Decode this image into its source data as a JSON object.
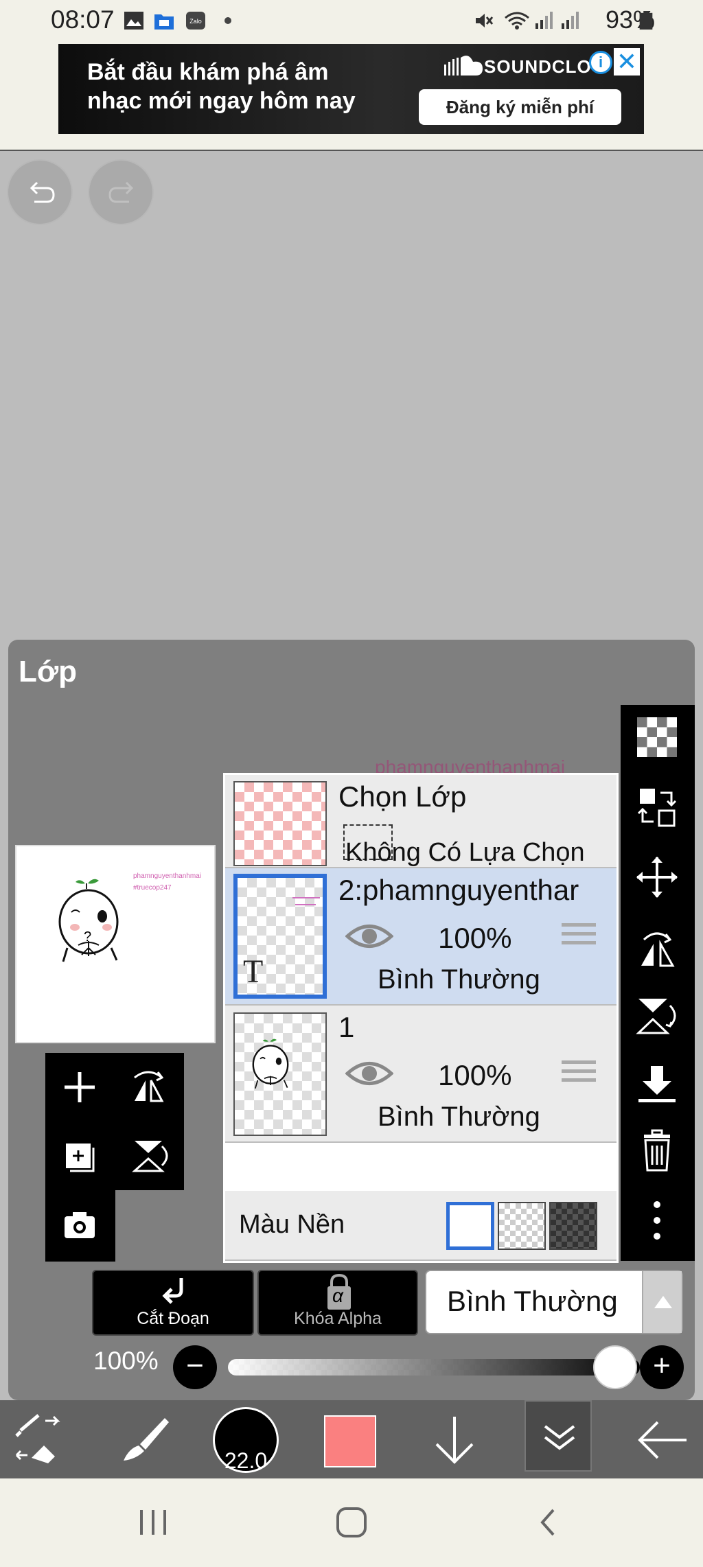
{
  "status_bar": {
    "time": "08:07",
    "battery": "93%",
    "left_icons": [
      "gallery-icon",
      "files-icon",
      "zalo-icon",
      "dot-icon"
    ],
    "right_icons": [
      "mute-icon",
      "wifi-icon",
      "signal-icon",
      "signal-icon",
      "battery-icon"
    ]
  },
  "ad": {
    "line1": "Bắt đầu khám phá âm",
    "line2": "nhạc mới ngay hôm nay",
    "brand": "SOUNDCLO",
    "cta": "Đăng ký miễn phí",
    "info": "i",
    "close": "✕"
  },
  "canvas": {
    "undo_icon": "undo-icon",
    "redo_icon": "redo-icon"
  },
  "layers_panel": {
    "title": "Lớp",
    "watermark": "phamnguyenthanhmai",
    "preview_text1": "phamnguyenthanhmai",
    "preview_text2": "#truecop247",
    "select_layer": {
      "title": "Chọn Lớp",
      "status": "Không Có Lựa Chọn"
    },
    "layers": [
      {
        "name": "2:phamnguyenthar",
        "opacity": "100%",
        "blend": "Bình Thường",
        "thumb_text": "T",
        "selected": true
      },
      {
        "name": "1",
        "opacity": "100%",
        "blend": "Bình Thường",
        "selected": false
      }
    ],
    "background": {
      "label": "Màu Nền",
      "options": [
        "white",
        "transparent",
        "dark"
      ],
      "selected": "white"
    },
    "cut_button": "Cắt Đoạn",
    "alpha_lock_button": "Khóa Alpha",
    "alpha_symbol": "α",
    "blend_mode": "Bình Thường",
    "opacity_label": "100%",
    "opacity_value": 1.0,
    "minus": "−",
    "plus": "+"
  },
  "toolbar": {
    "brush_size": "22.0",
    "current_color": "#fa8080"
  },
  "colors": {
    "accent": "#2f6fd6",
    "panel": "#7f7f7f",
    "selected_row": "#cfdcf0"
  }
}
